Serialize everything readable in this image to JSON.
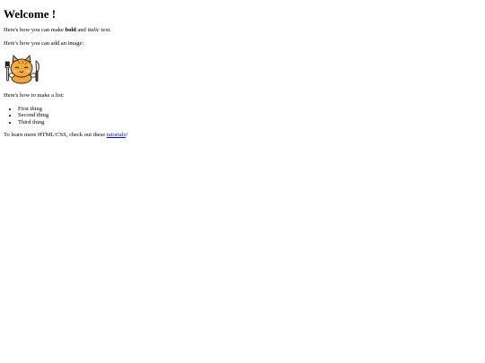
{
  "page": {
    "heading": "Welcome !",
    "intro": {
      "before": "Here's how you can make ",
      "bold": "bold",
      "middle": " and ",
      "italic": "italic",
      "after": " text."
    },
    "image_intro": "Here's how you can add an image:",
    "image": {
      "icon": "cat-with-fork-and-knife-icon"
    },
    "list_intro": "Here's how to make a list:",
    "list_items": [
      "First thing",
      "Second thing",
      "Third thing"
    ],
    "outro": {
      "before": "To learn more HTML/CSS, check out these ",
      "link": "tutorials",
      "after": "!"
    }
  }
}
